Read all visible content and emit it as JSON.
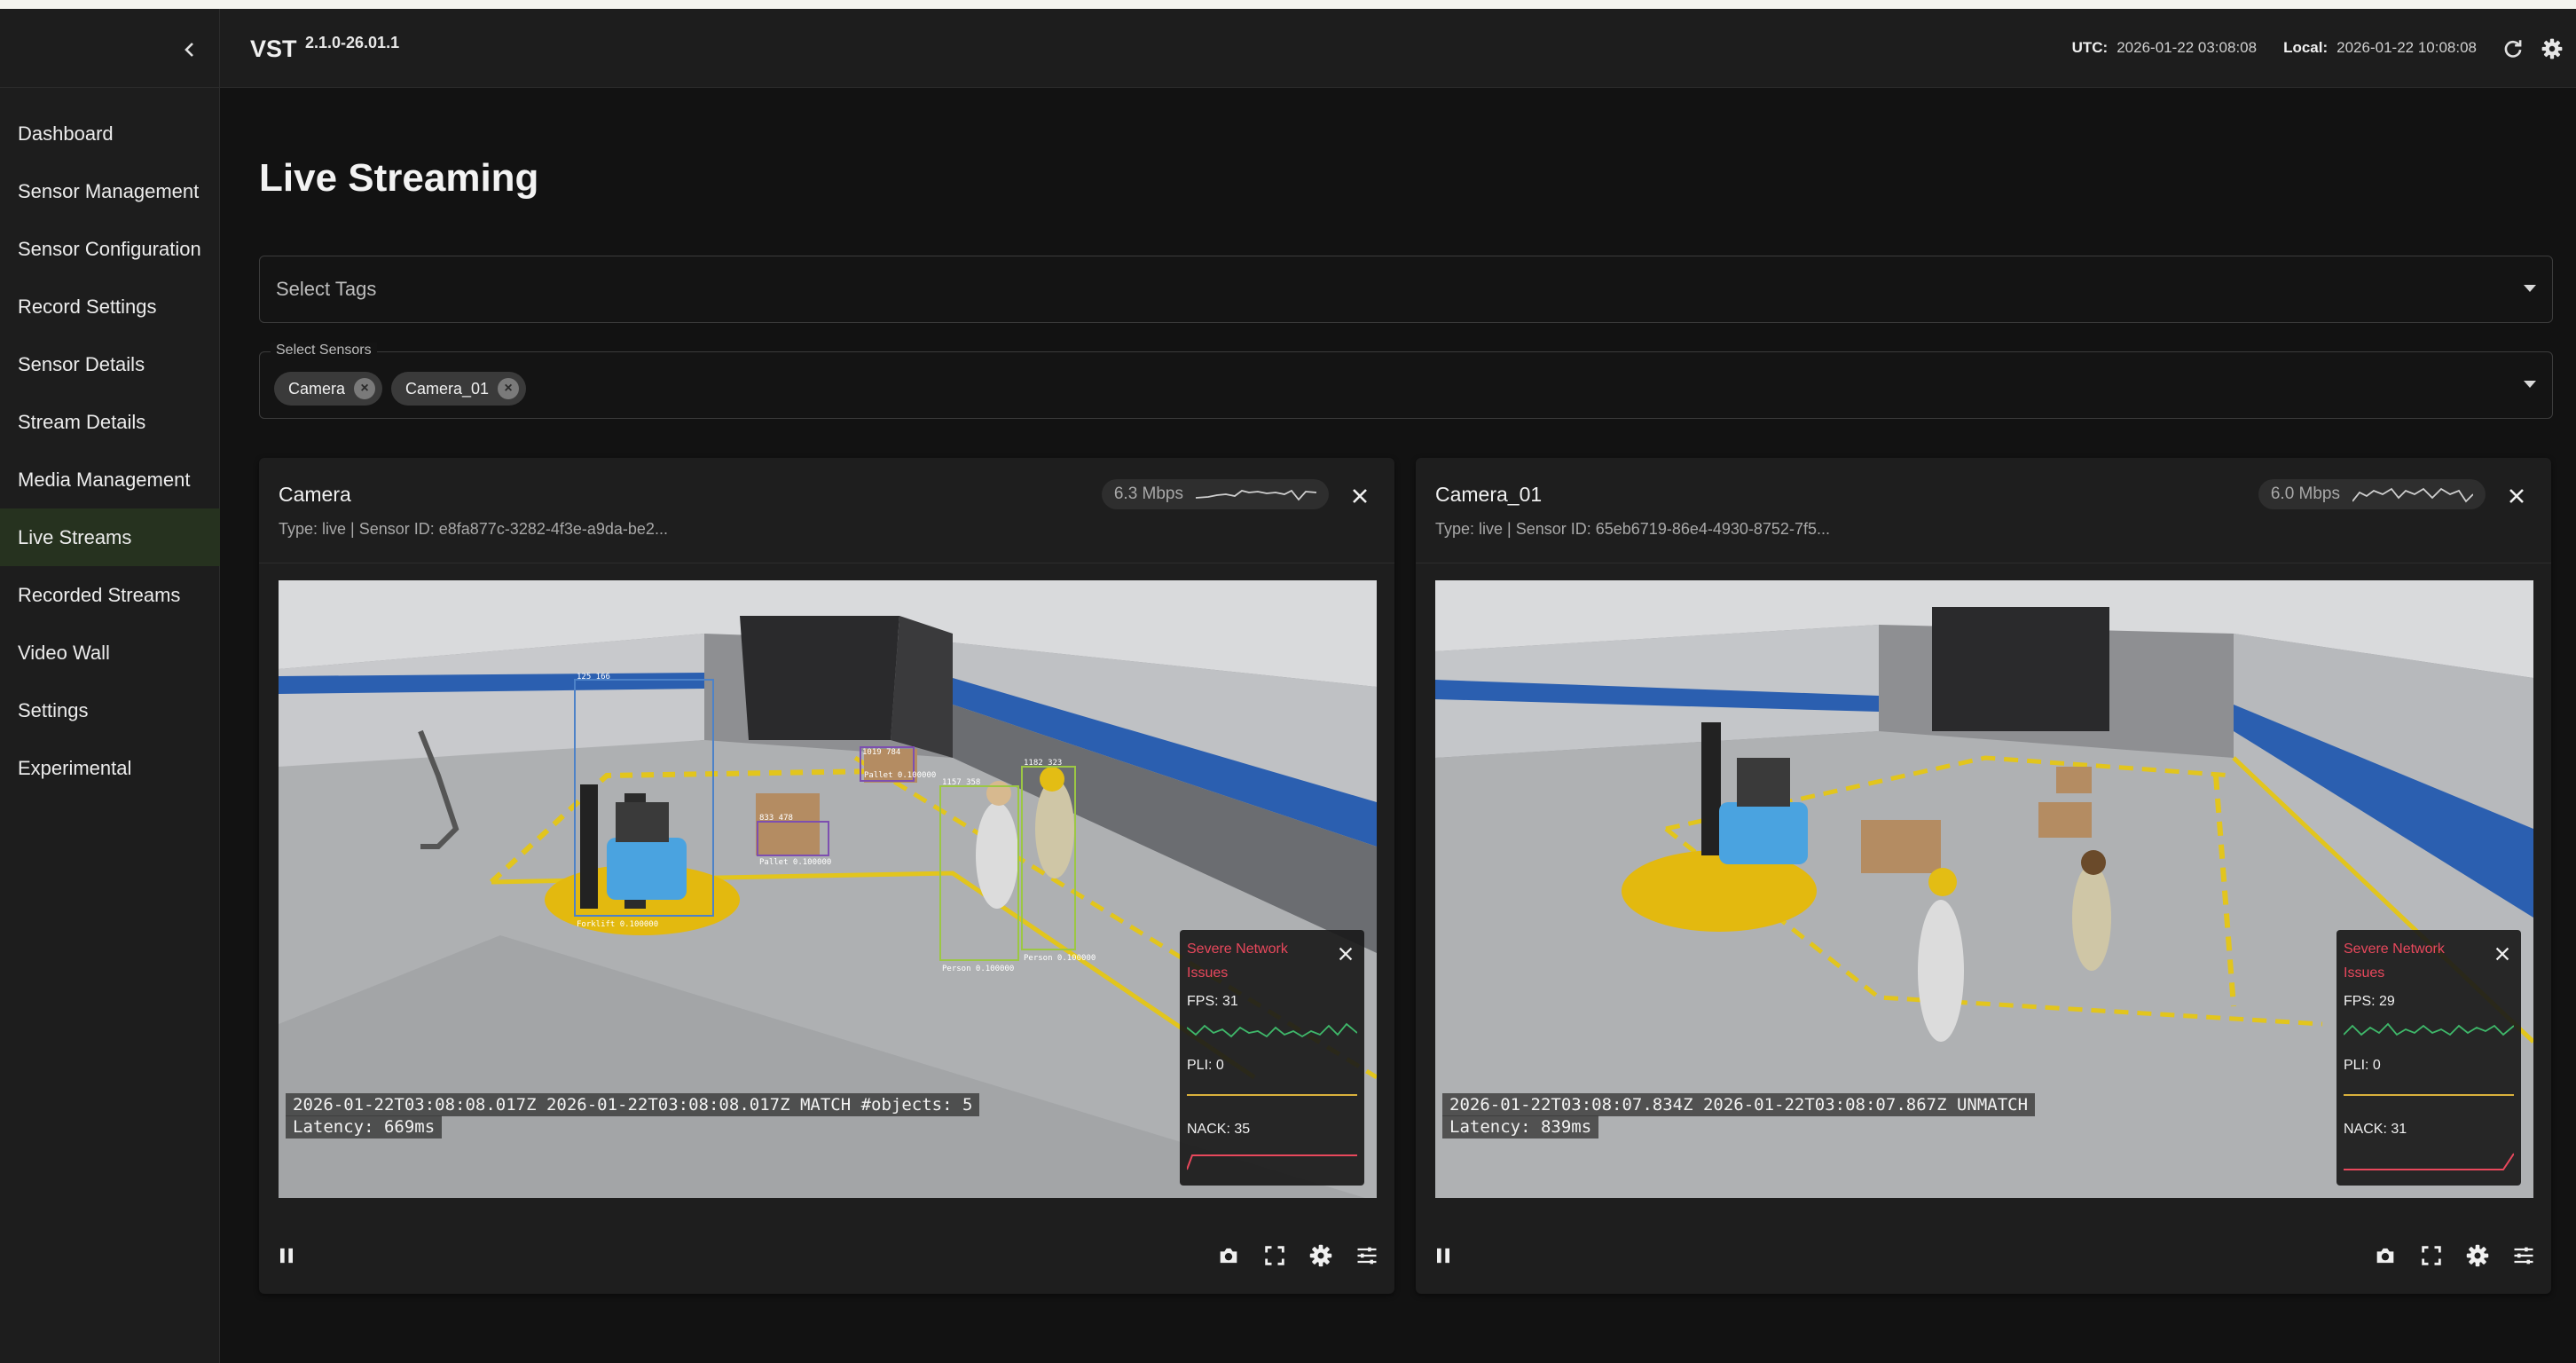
{
  "app": {
    "brand": "VST",
    "version": "2.1.0-26.01.1"
  },
  "header": {
    "utc_label": "UTC:",
    "utc_value": "2026-01-22 03:08:08",
    "local_label": "Local:",
    "local_value": "2026-01-22 10:08:08",
    "icons": [
      "refresh-icon",
      "gear-icon"
    ]
  },
  "sidebar": {
    "items": [
      {
        "label": "Dashboard"
      },
      {
        "label": "Sensor Management"
      },
      {
        "label": "Sensor Configuration"
      },
      {
        "label": "Record Settings"
      },
      {
        "label": "Sensor Details"
      },
      {
        "label": "Stream Details"
      },
      {
        "label": "Media Management"
      },
      {
        "label": "Live Streams",
        "active": true
      },
      {
        "label": "Recorded Streams"
      },
      {
        "label": "Video Wall"
      },
      {
        "label": "Settings"
      },
      {
        "label": "Experimental"
      }
    ]
  },
  "main": {
    "title": "Live Streaming",
    "tags": {
      "placeholder": "Select Tags"
    },
    "sensors": {
      "label": "Select Sensors",
      "chips": [
        "Camera",
        "Camera_01"
      ]
    }
  },
  "streams": [
    {
      "name": "Camera",
      "subtitle": "Type: live | Sensor ID: e8fa877c-3282-4f3e-a9da-be2...",
      "bitrate": "6.3 Mbps",
      "overlay_line1": "2026-01-22T03:08:08.017Z  2026-01-22T03:08:08.017Z MATCH #objects: 5",
      "overlay_line2": "Latency: 669ms",
      "warning": "Severe Network Issues",
      "fps": "FPS: 31",
      "pli": "PLI: 0",
      "nack": "NACK: 35"
    },
    {
      "name": "Camera_01",
      "subtitle": "Type: live | Sensor ID: 65eb6719-86e4-4930-8752-7f5...",
      "bitrate": "6.0 Mbps",
      "overlay_line1": "2026-01-22T03:08:07.834Z  2026-01-22T03:08:07.867Z UNMATCH",
      "overlay_line2": "Latency: 839ms",
      "warning": "Severe Network Issues",
      "fps": "FPS: 29",
      "pli": "PLI: 0",
      "nack": "NACK: 31"
    }
  ],
  "detections": [
    {
      "label": "Forklift  0.100000",
      "tag": "125  166"
    },
    {
      "label": "Pallet  0.100000",
      "tag": "833  478"
    },
    {
      "label": "Pallet  0.100000",
      "tag": "1019  784"
    },
    {
      "label": "Person  0.100000",
      "tag": "1157  358"
    },
    {
      "label": "Person  0.100000",
      "tag": "1182  323"
    }
  ],
  "controls": [
    "pause-icon",
    "camera-icon",
    "fullscreen-icon",
    "gear-icon",
    "tune-icon"
  ],
  "colors": {
    "warning": "#e8485c",
    "fps_line": "#3fb86a",
    "pli_line": "#d9b13c",
    "nack_line": "#e8485c",
    "active_nav": "#26321f"
  }
}
